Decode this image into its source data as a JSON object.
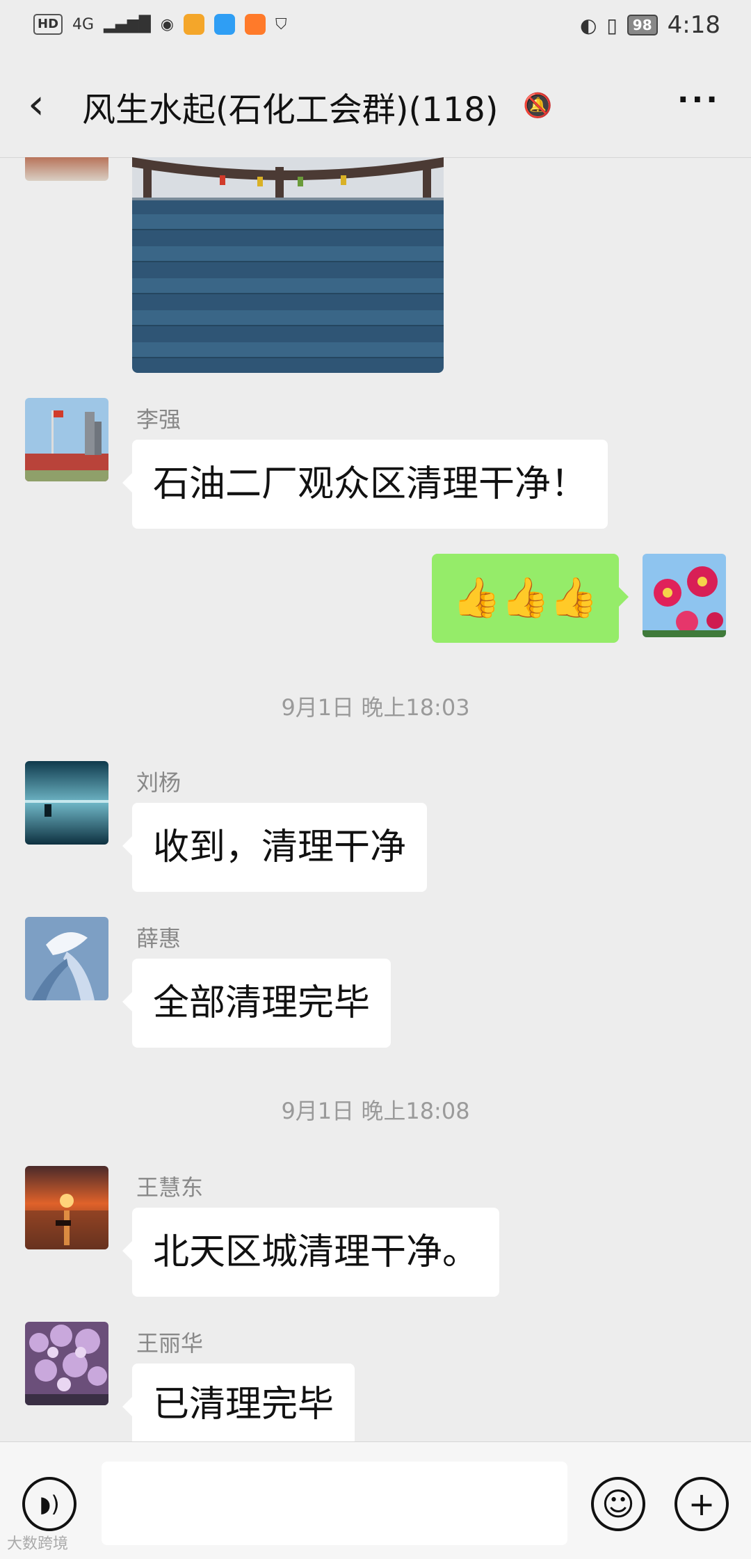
{
  "status_bar": {
    "hd": "HD",
    "network": "4G",
    "battery": "98",
    "time": "4:18"
  },
  "header": {
    "back_icon": "chevron-left-icon",
    "title": "风生水起(石化工会群)(118)",
    "mute_icon": "bell-off-icon",
    "more_icon": "more-dots-icon"
  },
  "messages": [
    {
      "sender": "李强",
      "text": "石油二厂观众区清理干净！"
    },
    {
      "sender": "me",
      "text": "👍👍👍"
    },
    {
      "sender": "刘杨",
      "text": "收到，清理干净"
    },
    {
      "sender": "薛惠",
      "text": "全部清理完毕"
    },
    {
      "sender": "王慧东",
      "text": "北天区城清理干净。"
    },
    {
      "sender": "王丽华",
      "text": "已清理完毕"
    }
  ],
  "timestamps": [
    "9月1日 晚上18:03",
    "9月1日 晚上18:08"
  ],
  "input_bar": {
    "voice_icon": "voice-icon",
    "emoji_icon": "emoji-icon",
    "plus_icon": "plus-icon",
    "emoji_glyph": "☺",
    "plus_glyph": "+"
  },
  "watermark": "大数跨境"
}
